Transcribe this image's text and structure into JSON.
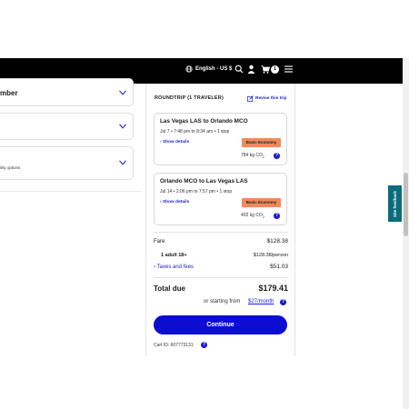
{
  "navbar": {
    "language": "English - US $",
    "cart_count": "1",
    "icons": [
      "globe-icon",
      "search-icon",
      "user-icon",
      "cart-icon",
      "menu-icon"
    ]
  },
  "left_panels": {
    "first_label": "mber",
    "third_sublabel": "ility options"
  },
  "summary": {
    "title": "ROUNDTRIP (1 TRAVELER)",
    "revise_label": "Revise this trip",
    "flights": [
      {
        "route": "Las Vegas LAS to Orlando MCO",
        "times": "Jul 7 • 7:48 pm to 8:34 am • 1 stop",
        "details_label": "Show details",
        "fare_class": "Basic Economy",
        "co2": "784 kg CO",
        "co2_sub": "2"
      },
      {
        "route": "Orlando MCO to Las Vegas LAS",
        "times": "Jul 14 • 2:06 pm to 7:57 pm • 1 stop",
        "details_label": "Show details",
        "fare_class": "Basic Economy",
        "co2": "402 kg CO",
        "co2_sub": "2"
      }
    ],
    "fare_label": "Fare",
    "fare_value": "$128.38",
    "adult_label": "1 adult 18+",
    "adult_value": "$128.38/person",
    "taxes_label": "Taxes and fees",
    "taxes_value": "$51.03",
    "total_label": "Total due",
    "total_value": "$179.41",
    "starting_label": "or starting from",
    "monthly_label": "$27/month",
    "continue_label": "Continue",
    "cart_id": "Cart ID: 607773131"
  },
  "feedback_label": "Site feedback",
  "colors": {
    "accent": "#0d0dd1",
    "badge": "#f2895b",
    "feedback": "#0a6b7c",
    "navbar": "#000000"
  }
}
